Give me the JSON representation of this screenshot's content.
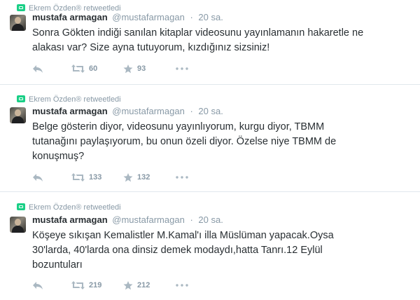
{
  "tweets": [
    {
      "retweeter_name": "Ekrem Özden",
      "retweeted_label": "retweetledi",
      "fullname": "mustafa armagan",
      "username": "@mustafarmagan",
      "separator": "·",
      "time": "20 sa.",
      "text_lines": [
        "Sonra Gökten indiği sanılan kitaplar videosunu yayınlamanın hakaretle ne",
        "alakası var? Size ayna tutuyorum, kızdığınız sizsiniz!"
      ],
      "retweet_count": "60",
      "favorite_count": "93"
    },
    {
      "retweeter_name": "Ekrem Özden",
      "retweeted_label": "retweetledi",
      "fullname": "mustafa armagan",
      "username": "@mustafarmagan",
      "separator": "·",
      "time": "20 sa.",
      "text_lines": [
        "Belge gösterin diyor, videosunu yayınlıyorum, kurgu diyor, TBMM",
        "tutanağını paylaşıyorum, bu onun özeli diyor. Özelse niye TBMM de",
        "konuşmuş?"
      ],
      "retweet_count": "133",
      "favorite_count": "132"
    },
    {
      "retweeter_name": "Ekrem Özden",
      "retweeted_label": "retweetledi",
      "fullname": "mustafa armagan",
      "username": "@mustafarmagan",
      "separator": "·",
      "time": "20 sa.",
      "text_lines": [
        "Köşeye sıkışan Kemalistler M.Kamal'ı illa Müslüman yapacak.Oysa",
        "30'larda, 40'larda ona dinsiz demek modaydı,hatta Tanrı.12 Eylül",
        "bozuntuları"
      ],
      "retweet_count": "219",
      "favorite_count": "212"
    }
  ],
  "icons": {
    "retweet_badge": "retweet-badge-icon",
    "reply": "reply-icon",
    "retweet": "retweet-icon",
    "favorite": "star-icon",
    "more": "more-dots-icon"
  },
  "colors": {
    "text": "#292f33",
    "muted": "#8899a6",
    "retweet_green": "#19cf86",
    "divider": "#e1e8ed",
    "icon_gray": "#aab8c2"
  }
}
